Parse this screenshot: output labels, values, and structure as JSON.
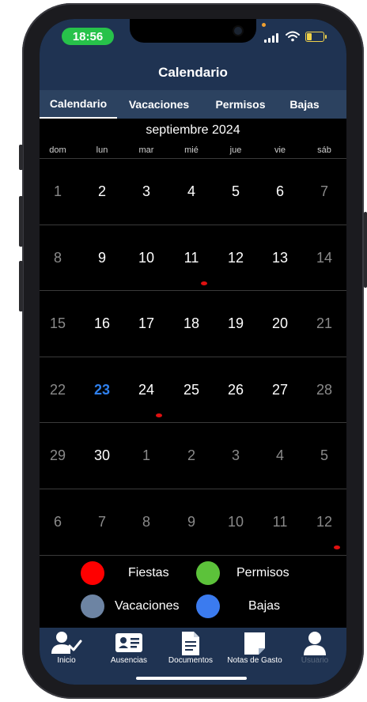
{
  "status_bar": {
    "time": "18:56"
  },
  "header": {
    "title": "Calendario"
  },
  "tabs": [
    {
      "label": "Calendario",
      "active": true
    },
    {
      "label": "Vacaciones",
      "active": false
    },
    {
      "label": "Permisos",
      "active": false
    },
    {
      "label": "Bajas",
      "active": false
    }
  ],
  "calendar": {
    "month_label": "septiembre 2024",
    "weekdays": [
      "dom",
      "lun",
      "mar",
      "mié",
      "jue",
      "vie",
      "sáb"
    ],
    "today": "23",
    "weeks": [
      [
        {
          "d": "1",
          "s": "weekend"
        },
        {
          "d": "2",
          "s": "normal"
        },
        {
          "d": "3",
          "s": "normal"
        },
        {
          "d": "4",
          "s": "normal"
        },
        {
          "d": "5",
          "s": "normal"
        },
        {
          "d": "6",
          "s": "normal"
        },
        {
          "d": "7",
          "s": "weekend"
        }
      ],
      [
        {
          "d": "8",
          "s": "weekend"
        },
        {
          "d": "9",
          "s": "normal"
        },
        {
          "d": "10",
          "s": "normal"
        },
        {
          "d": "11",
          "s": "normal"
        },
        {
          "d": "12",
          "s": "normal"
        },
        {
          "d": "13",
          "s": "normal"
        },
        {
          "d": "14",
          "s": "weekend"
        }
      ],
      [
        {
          "d": "15",
          "s": "weekend"
        },
        {
          "d": "16",
          "s": "normal"
        },
        {
          "d": "17",
          "s": "normal"
        },
        {
          "d": "18",
          "s": "normal"
        },
        {
          "d": "19",
          "s": "normal"
        },
        {
          "d": "20",
          "s": "normal"
        },
        {
          "d": "21",
          "s": "weekend"
        }
      ],
      [
        {
          "d": "22",
          "s": "weekend"
        },
        {
          "d": "23",
          "s": "today"
        },
        {
          "d": "24",
          "s": "normal"
        },
        {
          "d": "25",
          "s": "normal"
        },
        {
          "d": "26",
          "s": "normal"
        },
        {
          "d": "27",
          "s": "normal"
        },
        {
          "d": "28",
          "s": "weekend"
        }
      ],
      [
        {
          "d": "29",
          "s": "weekend"
        },
        {
          "d": "30",
          "s": "normal"
        },
        {
          "d": "1",
          "s": "other"
        },
        {
          "d": "2",
          "s": "other"
        },
        {
          "d": "3",
          "s": "other"
        },
        {
          "d": "4",
          "s": "other"
        },
        {
          "d": "5",
          "s": "other"
        }
      ],
      [
        {
          "d": "6",
          "s": "other"
        },
        {
          "d": "7",
          "s": "other"
        },
        {
          "d": "8",
          "s": "other"
        },
        {
          "d": "9",
          "s": "other"
        },
        {
          "d": "10",
          "s": "other"
        },
        {
          "d": "11",
          "s": "other"
        },
        {
          "d": "12",
          "s": "other"
        }
      ]
    ],
    "event_markers": [
      {
        "week": 1,
        "weekday": 3,
        "type": "fiesta"
      },
      {
        "week": 3,
        "weekday": 2,
        "type": "fiesta"
      },
      {
        "week": 5,
        "weekday": 6,
        "type": "fiesta"
      }
    ]
  },
  "legend": [
    {
      "label": "Fiestas",
      "color": "#ff0000"
    },
    {
      "label": "Permisos",
      "color": "#5cc23a"
    },
    {
      "label": "Vacaciones",
      "color": "#6d84a3"
    },
    {
      "label": "Bajas",
      "color": "#3b7bef"
    }
  ],
  "bottom_nav": [
    {
      "label": "Inicio",
      "icon": "user-check-icon"
    },
    {
      "label": "Ausencias",
      "icon": "id-card-icon"
    },
    {
      "label": "Documentos",
      "icon": "document-icon"
    },
    {
      "label": "Notas de Gasto",
      "icon": "note-icon"
    },
    {
      "label": "Usuario",
      "icon": "user-icon"
    }
  ],
  "colors": {
    "header_bg": "#1f3352",
    "tabbar_bg": "#2c4260",
    "today": "#2f80ed",
    "weekend_text": "#8a8a8a",
    "event_dot": "#e01010"
  }
}
